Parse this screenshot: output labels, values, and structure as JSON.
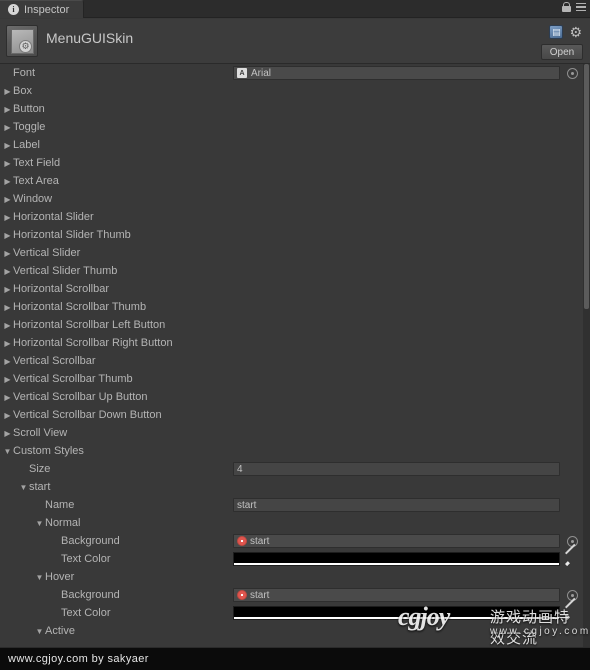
{
  "window": {
    "tab_label": "Inspector",
    "tab_icon": "info-icon",
    "lock_icon": "lock-icon",
    "menu_icon": "hamburger-menu-icon"
  },
  "asset": {
    "icon_name": "guiskin-asset-icon",
    "title": "MenuGUISkin",
    "open_label": "Open",
    "preset_icon": "preset-selector-icon",
    "gear_icon": "gear-icon"
  },
  "properties": [
    {
      "label": "Font",
      "indent": 0,
      "foldout": "none",
      "control": "object",
      "value": "Arial",
      "icon": "font-asset-icon",
      "picker": true
    },
    {
      "label": "Box",
      "indent": 0,
      "foldout": "collapsed",
      "control": "none"
    },
    {
      "label": "Button",
      "indent": 0,
      "foldout": "collapsed",
      "control": "none"
    },
    {
      "label": "Toggle",
      "indent": 0,
      "foldout": "collapsed",
      "control": "none"
    },
    {
      "label": "Label",
      "indent": 0,
      "foldout": "collapsed",
      "control": "none"
    },
    {
      "label": "Text Field",
      "indent": 0,
      "foldout": "collapsed",
      "control": "none"
    },
    {
      "label": "Text Area",
      "indent": 0,
      "foldout": "collapsed",
      "control": "none"
    },
    {
      "label": "Window",
      "indent": 0,
      "foldout": "collapsed",
      "control": "none"
    },
    {
      "label": "Horizontal Slider",
      "indent": 0,
      "foldout": "collapsed",
      "control": "none"
    },
    {
      "label": "Horizontal Slider Thumb",
      "indent": 0,
      "foldout": "collapsed",
      "control": "none"
    },
    {
      "label": "Vertical Slider",
      "indent": 0,
      "foldout": "collapsed",
      "control": "none"
    },
    {
      "label": "Vertical Slider Thumb",
      "indent": 0,
      "foldout": "collapsed",
      "control": "none"
    },
    {
      "label": "Horizontal Scrollbar",
      "indent": 0,
      "foldout": "collapsed",
      "control": "none"
    },
    {
      "label": "Horizontal Scrollbar Thumb",
      "indent": 0,
      "foldout": "collapsed",
      "control": "none"
    },
    {
      "label": "Horizontal Scrollbar Left Button",
      "indent": 0,
      "foldout": "collapsed",
      "control": "none"
    },
    {
      "label": "Horizontal Scrollbar Right Button",
      "indent": 0,
      "foldout": "collapsed",
      "control": "none"
    },
    {
      "label": "Vertical Scrollbar",
      "indent": 0,
      "foldout": "collapsed",
      "control": "none"
    },
    {
      "label": "Vertical Scrollbar Thumb",
      "indent": 0,
      "foldout": "collapsed",
      "control": "none"
    },
    {
      "label": "Vertical Scrollbar Up Button",
      "indent": 0,
      "foldout": "collapsed",
      "control": "none"
    },
    {
      "label": "Vertical Scrollbar Down Button",
      "indent": 0,
      "foldout": "collapsed",
      "control": "none"
    },
    {
      "label": "Scroll View",
      "indent": 0,
      "foldout": "collapsed",
      "control": "none"
    },
    {
      "label": "Custom Styles",
      "indent": 0,
      "foldout": "expanded",
      "control": "none"
    },
    {
      "label": "Size",
      "indent": 1,
      "foldout": "none",
      "control": "text",
      "value": "4"
    },
    {
      "label": "start",
      "indent": 1,
      "foldout": "expanded",
      "control": "none"
    },
    {
      "label": "Name",
      "indent": 2,
      "foldout": "none",
      "control": "text",
      "value": "start"
    },
    {
      "label": "Normal",
      "indent": 2,
      "foldout": "expanded",
      "control": "none"
    },
    {
      "label": "Background",
      "indent": 3,
      "foldout": "none",
      "control": "object",
      "value": "start",
      "icon": "texture-asset-icon",
      "picker": true
    },
    {
      "label": "Text Color",
      "indent": 3,
      "foldout": "none",
      "control": "color",
      "value": "#000000",
      "eyedropper": true
    },
    {
      "label": "Hover",
      "indent": 2,
      "foldout": "expanded",
      "control": "none"
    },
    {
      "label": "Background",
      "indent": 3,
      "foldout": "none",
      "control": "object",
      "value": "start",
      "icon": "texture-asset-icon",
      "picker": true
    },
    {
      "label": "Text Color",
      "indent": 3,
      "foldout": "none",
      "control": "color",
      "value": "#000000",
      "eyedropper": true
    },
    {
      "label": "Active",
      "indent": 2,
      "foldout": "expanded",
      "control": "none"
    }
  ],
  "watermark": {
    "logo": "cgjoy",
    "tagline": "游戏动画特效交流",
    "url": "www.cgjoy.com"
  },
  "status": {
    "text": "www.cgjoy.com by sakyaer"
  },
  "colors": {
    "panel_bg": "#393939",
    "header_bg": "#3c3c3c",
    "field_bg": "#454545",
    "label": "#b4b4b4",
    "texture_accent": "#e0564f",
    "statusbar_bg": "#0b0b0b"
  }
}
